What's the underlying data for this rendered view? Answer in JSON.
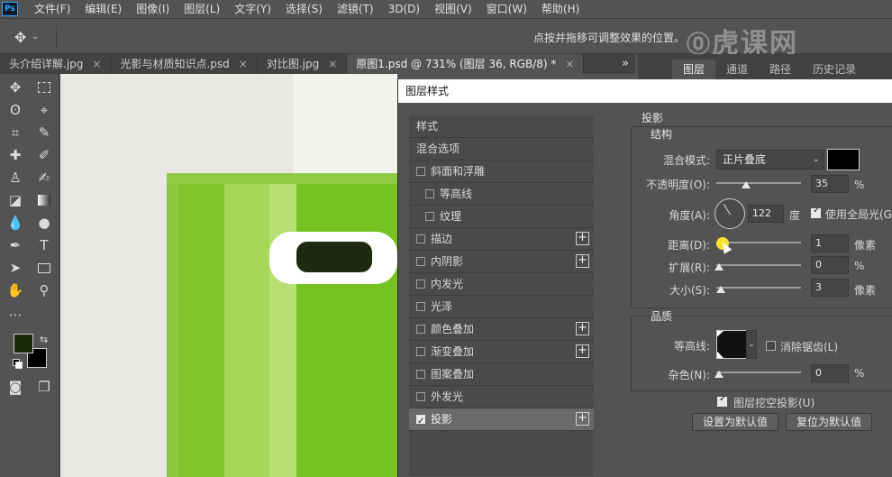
{
  "app": {
    "logo": "Ps",
    "menu": [
      "文件(F)",
      "编辑(E)",
      "图像(I)",
      "图层(L)",
      "文字(Y)",
      "选择(S)",
      "滤镜(T)",
      "3D(D)",
      "视图(V)",
      "窗口(W)",
      "帮助(H)"
    ]
  },
  "options": {
    "hint": "点按并拖移可调整效果的位置。",
    "watermark": "虎课网"
  },
  "tabs": [
    {
      "label": "头介绍详解.jpg",
      "close": "×"
    },
    {
      "label": "光影与材质知识点.psd",
      "close": "×"
    },
    {
      "label": "对比图.jpg",
      "close": "×"
    },
    {
      "label": "原图1.psd @ 731% (图层 36, RGB/8) *",
      "close": "×",
      "active": true
    }
  ],
  "tab_overflow": "»",
  "panel_tabs": [
    "图层",
    "通道",
    "路径",
    "历史记录"
  ],
  "dialog": {
    "title": "图层样式",
    "styles": [
      {
        "label": "样式",
        "checkbox": false,
        "plus": false
      },
      {
        "label": "混合选项",
        "checkbox": false,
        "plus": false
      },
      {
        "label": "斜面和浮雕",
        "checkbox": true,
        "checked": false,
        "plus": false,
        "indent": 0
      },
      {
        "label": "等高线",
        "checkbox": true,
        "checked": false,
        "plus": false,
        "indent": 1
      },
      {
        "label": "纹理",
        "checkbox": true,
        "checked": false,
        "plus": false,
        "indent": 1
      },
      {
        "label": "描边",
        "checkbox": true,
        "checked": false,
        "plus": true
      },
      {
        "label": "内阴影",
        "checkbox": true,
        "checked": false,
        "plus": true
      },
      {
        "label": "内发光",
        "checkbox": true,
        "checked": false,
        "plus": false
      },
      {
        "label": "光泽",
        "checkbox": true,
        "checked": false,
        "plus": false
      },
      {
        "label": "颜色叠加",
        "checkbox": true,
        "checked": false,
        "plus": true
      },
      {
        "label": "渐变叠加",
        "checkbox": true,
        "checked": false,
        "plus": true
      },
      {
        "label": "图案叠加",
        "checkbox": true,
        "checked": false,
        "plus": false
      },
      {
        "label": "外发光",
        "checkbox": true,
        "checked": false,
        "plus": false
      },
      {
        "label": "投影",
        "checkbox": true,
        "checked": true,
        "plus": true,
        "selected": true
      }
    ],
    "drop_shadow": {
      "title": "投影",
      "structure_title": "结构",
      "blend_mode_label": "混合模式:",
      "blend_mode": "正片叠底",
      "shadow_color": "#000000",
      "opacity_label": "不透明度(O):",
      "opacity": "35",
      "opacity_fraction": 0.35,
      "percent": "%",
      "angle_label": "角度(A):",
      "angle": "122",
      "angle_unit": "度",
      "global_light_label": "使用全局光(G)",
      "distance_label": "距离(D):",
      "distance": "1",
      "pixel_unit": "像素",
      "spread_label": "扩展(R):",
      "spread": "0",
      "size_label": "大小(S):",
      "size": "3",
      "quality_title": "品质",
      "contour_label": "等高线:",
      "antialias_label": "消除锯齿(L)",
      "noise_label": "杂色(N):",
      "noise": "0",
      "knockout_label": "图层挖空投影(U)",
      "make_default": "设置为默认值",
      "reset_default": "复位为默认值"
    }
  }
}
